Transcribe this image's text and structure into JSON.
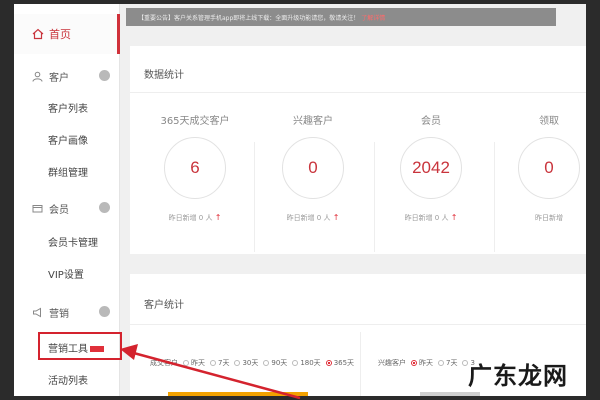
{
  "sidebar": {
    "home_label": "首页",
    "groups": [
      {
        "label": "客户",
        "items": [
          "客户列表",
          "客户画像",
          "群组管理"
        ]
      },
      {
        "label": "会员",
        "items": [
          "会员卡管理",
          "VIP设置"
        ]
      },
      {
        "label": "营销",
        "items": [
          "营销工具",
          "活动列表"
        ]
      }
    ]
  },
  "notice": {
    "text": "【重要公告】客户关系管理手机app即将上线下载：全面升级功能请您，敬请关注！",
    "link": "了解详情"
  },
  "data_stats": {
    "title": "数据统计",
    "stats": [
      {
        "label": "365天成交客户",
        "value": "6",
        "yesterday": "昨日新增 0 人"
      },
      {
        "label": "兴趣客户",
        "value": "0",
        "yesterday": "昨日新增 0 人"
      },
      {
        "label": "会员",
        "value": "2042",
        "yesterday": "昨日新增 0 人"
      },
      {
        "label": "领取",
        "value": "0",
        "yesterday": "昨日新增"
      }
    ],
    "up_arrow": "↑"
  },
  "customer_stats": {
    "title": "客户统计",
    "left_label": "成交客户",
    "right_label": "兴趣客户",
    "ranges": [
      "昨天",
      "7天",
      "30天",
      "90天",
      "180天",
      "365天"
    ],
    "left_selected": "365天",
    "right_ranges": [
      "昨天",
      "7天",
      "3"
    ]
  },
  "watermark": "广东龙网",
  "colors": {
    "accent": "#d0313a",
    "orange": "#f3a200"
  }
}
